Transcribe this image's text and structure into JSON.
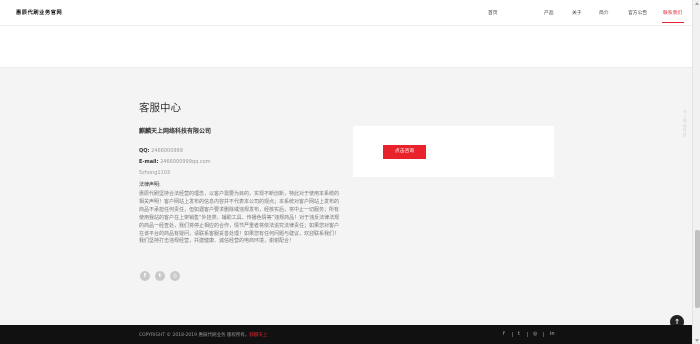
{
  "header": {
    "logo": "惠辰代刷业务官网",
    "nav": [
      {
        "label": "首页",
        "active": false
      },
      {
        "label": "产品",
        "active": false
      },
      {
        "label": "关于",
        "active": false
      },
      {
        "label": "简介",
        "active": false
      },
      {
        "label": "官方公告",
        "active": false
      },
      {
        "label": "联系我们",
        "active": true
      }
    ]
  },
  "contact": {
    "title": "客服中心",
    "company": "麒麟天上网络科技有限公司",
    "qq_label": "QQ:",
    "qq": "2466000999",
    "email_label": "E-mail:",
    "email": "2466000999qq.com",
    "wechat": "5zhong1103",
    "law_title": "法律声明:",
    "statement": "惠辰代刷坚持合法经营的理念，以客户需要为目的，实现不断创新，特此对于使用本系统的相关声明！客户网站上发布的信息内容并不代表本公司的观点；本系统对客户网站上发布的商品不承担任何责任，但如遇客户要求删除或违规发布，经核实后，将中止一切服务；所有使用我站的客户在上架销售“外挂类、辅助工具、传播色情等”违规商品！对于违反法律法规的商品一经查处，我们将停止相应的合作，情节严重者将依法追究法律责任；如果您对客户在该平台的商品有疑问，请联系客服妥善处理！如果您有任何问题与建议，欢迎联系我们！我们坚持打击违规经营，共建健康、诚信经营的电商环境，谢谢配合！",
    "consult_button": "点击咨询"
  },
  "social": {
    "icons": [
      "facebook-icon",
      "twitter-icon",
      "instagram-icon"
    ],
    "glyphs": [
      "f",
      "t",
      "◎"
    ]
  },
  "side_text": "天上网络科技",
  "back_to_top": "↑",
  "footer": {
    "copyright_prefix": "COPYRIGHT © 2018-2019 惠辰代刷业务 版权所有。",
    "copyright_link": "麒麟天上",
    "icons": [
      "f",
      "t",
      "◎",
      "in"
    ]
  },
  "colors": {
    "accent": "#e8232c",
    "footer_bg": "#111111",
    "page_bg": "#f4f4f4"
  }
}
